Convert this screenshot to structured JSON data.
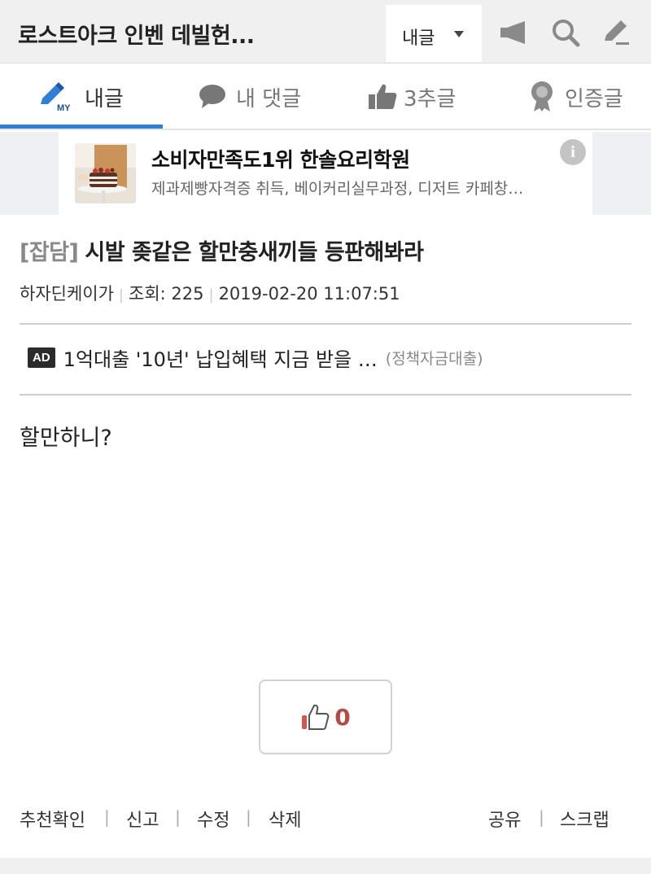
{
  "header": {
    "title": "로스트아크 인벤 데빌헌...",
    "dropdown_label": "내글",
    "icons": [
      "megaphone-icon",
      "search-icon",
      "pencil-icon"
    ]
  },
  "tabs": [
    {
      "label": "내글",
      "icon": "my-pencil-icon",
      "active": true
    },
    {
      "label": "내 댓글",
      "icon": "speech-bubble-icon",
      "active": false
    },
    {
      "label": "3추글",
      "icon": "thumbs-up-icon",
      "active": false
    },
    {
      "label": "인증글",
      "icon": "badge-icon",
      "active": false
    }
  ],
  "ad_banner": {
    "title": "소비자만족도1위 한솔요리학원",
    "description": "제과제빵자격증 취득, 베이커리실무과정, 디저트 카페창…",
    "info_icon": "i"
  },
  "post": {
    "category": "[잡담]",
    "title": "시발 좆같은 할만충새끼들 등판해봐라",
    "author": "하자딘케이가",
    "views_label": "조회: 225",
    "date": "2019-02-20 11:07:51",
    "body": "할만하니?"
  },
  "inline_ad": {
    "tag": "AD",
    "text": "1억대출 '10년' 납입혜택 지금 받을 …",
    "source": "(정책자금대출)"
  },
  "recommend": {
    "count": "0"
  },
  "actions": {
    "left": [
      "추천확인",
      "신고",
      "수정",
      "삭제"
    ],
    "right": [
      "공유",
      "스크랩"
    ],
    "separator": "|"
  },
  "colors": {
    "accent": "#2f7fd6",
    "recommend": "#b44a44"
  }
}
